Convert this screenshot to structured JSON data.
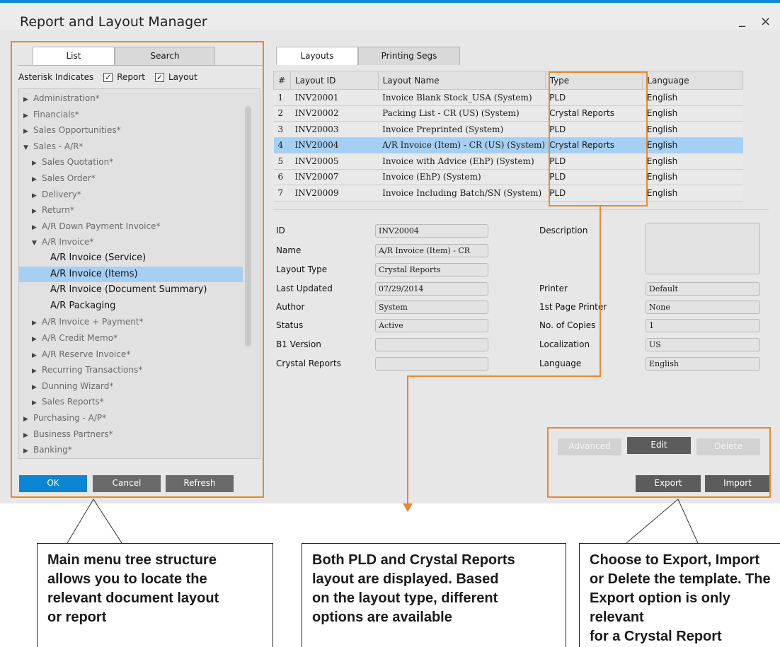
{
  "window": {
    "title": "Report and Layout Manager",
    "minimize": "_",
    "close": "×"
  },
  "left_tabs": {
    "list": "List",
    "search": "Search"
  },
  "asterisk": {
    "label": "Asterisk Indicates",
    "report": "Report",
    "layout": "Layout",
    "check": "✓"
  },
  "tree": [
    {
      "label": "Administration*",
      "arrow": "▶",
      "level": 0,
      "type": "folder"
    },
    {
      "label": "Financials*",
      "arrow": "▶",
      "level": 0,
      "type": "folder"
    },
    {
      "label": "Sales Opportunities*",
      "arrow": "▶",
      "level": 0,
      "type": "folder"
    },
    {
      "label": "Sales - A/R*",
      "arrow": "▼",
      "level": 0,
      "type": "folder"
    },
    {
      "label": "Sales Quotation*",
      "arrow": "▶",
      "level": 1,
      "type": "folder"
    },
    {
      "label": "Sales Order*",
      "arrow": "▶",
      "level": 1,
      "type": "folder"
    },
    {
      "label": "Delivery*",
      "arrow": "▶",
      "level": 1,
      "type": "folder"
    },
    {
      "label": "Return*",
      "arrow": "▶",
      "level": 1,
      "type": "folder"
    },
    {
      "label": "A/R Down Payment Invoice*",
      "arrow": "▶",
      "level": 1,
      "type": "folder"
    },
    {
      "label": "A/R Invoice*",
      "arrow": "▼",
      "level": 1,
      "type": "folder"
    },
    {
      "label": "A/R Invoice (Service)",
      "arrow": "",
      "level": 2,
      "type": "leaf"
    },
    {
      "label": "A/R Invoice (Items)",
      "arrow": "",
      "level": 2,
      "type": "leaf",
      "selected": true
    },
    {
      "label": "A/R Invoice (Document Summary)",
      "arrow": "",
      "level": 2,
      "type": "leaf"
    },
    {
      "label": "A/R Packaging",
      "arrow": "",
      "level": 2,
      "type": "leaf"
    },
    {
      "label": "A/R Invoice + Payment*",
      "arrow": "▶",
      "level": 1,
      "type": "folder"
    },
    {
      "label": "A/R Credit Memo*",
      "arrow": "▶",
      "level": 1,
      "type": "folder"
    },
    {
      "label": "A/R Reserve Invoice*",
      "arrow": "▶",
      "level": 1,
      "type": "folder"
    },
    {
      "label": "Recurring Transactions*",
      "arrow": "▶",
      "level": 1,
      "type": "folder"
    },
    {
      "label": "Dunning Wizard*",
      "arrow": "▶",
      "level": 1,
      "type": "folder"
    },
    {
      "label": "Sales Reports*",
      "arrow": "▶",
      "level": 1,
      "type": "folder"
    },
    {
      "label": "Purchasing - A/P*",
      "arrow": "▶",
      "level": 0,
      "type": "folder"
    },
    {
      "label": "Business Partners*",
      "arrow": "▶",
      "level": 0,
      "type": "folder"
    },
    {
      "label": "Banking*",
      "arrow": "▶",
      "level": 0,
      "type": "folder"
    }
  ],
  "left_buttons": {
    "ok": "OK",
    "cancel": "Cancel",
    "refresh": "Refresh"
  },
  "right_tabs": {
    "layouts": "Layouts",
    "printing_segs": "Printing Segs"
  },
  "grid": {
    "headers": [
      "#",
      "Layout ID",
      "Layout Name",
      "Type",
      "Language"
    ],
    "rows": [
      [
        "1",
        "INV20001",
        "Invoice Blank Stock_USA (System)",
        "PLD",
        "English"
      ],
      [
        "2",
        "INV20002",
        "Packing List - CR (US) (System)",
        "Crystal Reports",
        "English"
      ],
      [
        "3",
        "INV20003",
        "Invoice Preprinted (System)",
        "PLD",
        "English"
      ],
      [
        "4",
        "INV20004",
        "A/R Invoice (Item) - CR (US) (System)",
        "Crystal Reports",
        "English"
      ],
      [
        "5",
        "INV20005",
        "Invoice with Advice (EhP) (System)",
        "PLD",
        "English"
      ],
      [
        "6",
        "INV20007",
        "Invoice (EhP) (System)",
        "PLD",
        "English"
      ],
      [
        "7",
        "INV20009",
        "Invoice Including Batch/SN (System)",
        "PLD",
        "English"
      ]
    ],
    "selected_row": 3
  },
  "details": {
    "id_label": "ID",
    "id_value": "INV20004",
    "name_label": "Name",
    "name_value": "A/R Invoice (Item) - CR",
    "layout_type_label": "Layout Type",
    "layout_type_value": "Crystal Reports",
    "last_updated_label": "Last Updated",
    "last_updated_value": "07/29/2014",
    "author_label": "Author",
    "author_value": "System",
    "status_label": "Status",
    "status_value": "Active",
    "b1_version_label": "B1 Version",
    "b1_version_value": "",
    "crystal_reports_label": "Crystal Reports",
    "crystal_reports_value": "",
    "description_label": "Description",
    "printer_label": "Printer",
    "printer_value": "Default",
    "first_page_printer_label": "1st Page Printer",
    "first_page_printer_value": "None",
    "copies_label": "No. of Copies",
    "copies_value": "1",
    "localization_label": "Localization",
    "localization_value": "US",
    "language_label": "Language",
    "language_value": "English"
  },
  "right_buttons": {
    "advanced": "Advanced",
    "edit": "Edit",
    "delete": "Delete",
    "export": "Export",
    "import": "Import"
  },
  "callouts": {
    "left": "Main menu tree structure\nallows you to locate the\nrelevant document layout\nor report",
    "middle": "Both PLD and Crystal Reports\nlayout are displayed. Based\non the layout type, different\noptions are available",
    "right": "Choose to Export, Import\nor Delete the template. The\nExport option is only relevant\nfor a Crystal Report"
  },
  "colors": {
    "accent": "#0a86d4",
    "highlight": "#e9892b",
    "selection": "#a6d0f3"
  }
}
